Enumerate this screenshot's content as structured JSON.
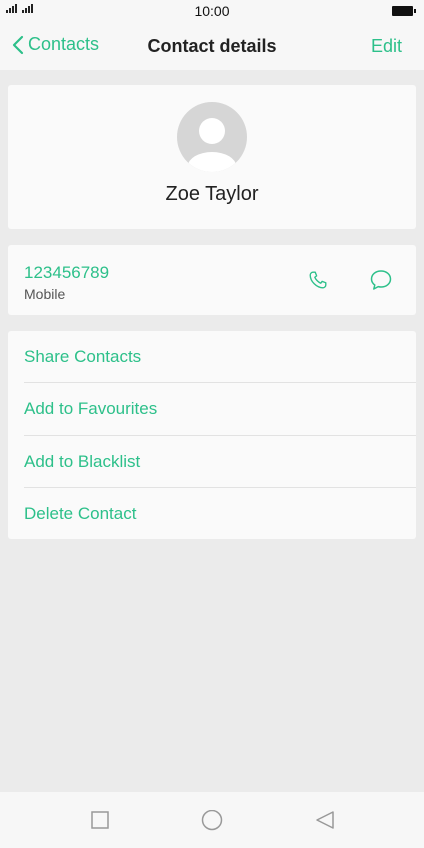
{
  "status_bar": {
    "time": "10:00"
  },
  "header": {
    "back_label": "Contacts",
    "title": "Contact details",
    "edit_label": "Edit"
  },
  "contact": {
    "name": "Zoe Taylor",
    "number": "123456789",
    "number_type": "Mobile"
  },
  "actions": [
    "Share Contacts",
    "Add to Favourites",
    "Add to Blacklist",
    "Delete Contact"
  ],
  "colors": {
    "accent": "#2dc08a",
    "background": "#ebebeb",
    "card": "#fafafa"
  },
  "icons": {
    "back": "chevron-left-icon",
    "call": "phone-icon",
    "message": "chat-bubble-icon",
    "nav_recents": "square-icon",
    "nav_home": "circle-icon",
    "nav_back": "triangle-left-icon"
  }
}
